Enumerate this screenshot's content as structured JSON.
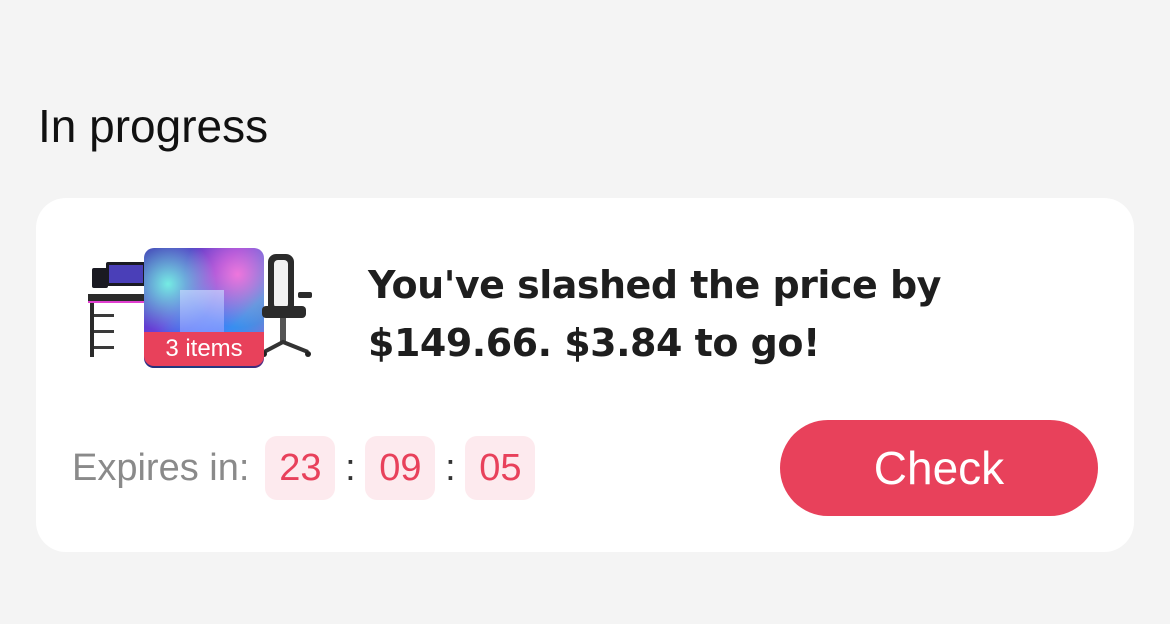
{
  "section": {
    "title": "In progress"
  },
  "card": {
    "items_badge": "3 items",
    "message": "You've slashed the price by $149.66. $3.84 to go!",
    "expires_label": "Expires in:",
    "countdown": {
      "hours": "23",
      "minutes": "09",
      "seconds": "05",
      "separator": ":"
    },
    "check_label": "Check"
  },
  "colors": {
    "accent": "#e8415b",
    "timer_bg": "#fdeaee",
    "page_bg": "#f4f4f4",
    "card_bg": "#ffffff"
  }
}
